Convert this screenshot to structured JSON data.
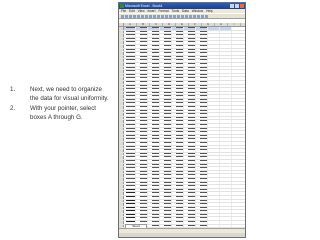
{
  "instructions": [
    {
      "num": "1.",
      "text": "Next, we need to organize the data for visual uniformity."
    },
    {
      "num": "2.",
      "text": "With your pointer, select boxes A through G."
    }
  ],
  "excel": {
    "title": "Microsoft Excel - Book1",
    "menu": [
      "File",
      "Edit",
      "View",
      "Insert",
      "Format",
      "Tools",
      "Data",
      "Window",
      "Help"
    ],
    "formula": "",
    "columns": [
      "A",
      "B",
      "C",
      "D",
      "E",
      "F",
      "G",
      "H",
      "I"
    ],
    "sheet_tab": "Sheet1"
  }
}
